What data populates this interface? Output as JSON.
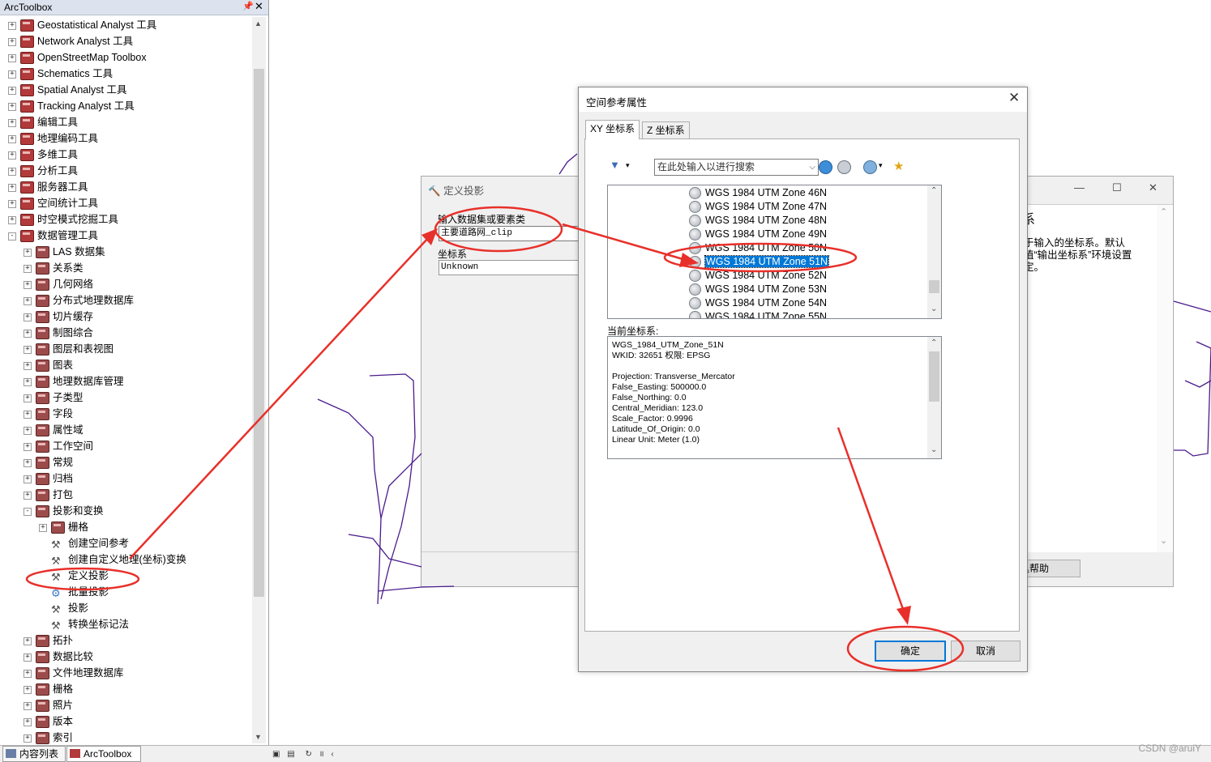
{
  "toolbox": {
    "title": "ArcToolbox",
    "pin_icon": "pin-icon",
    "close_icon": "close-icon",
    "items": [
      {
        "label": "Geostatistical Analyst 工具",
        "level": 0,
        "expand": "+",
        "icon": "toolbox-icon"
      },
      {
        "label": "Network Analyst 工具",
        "level": 0,
        "expand": "+",
        "icon": "toolbox-icon"
      },
      {
        "label": "OpenStreetMap Toolbox",
        "level": 0,
        "expand": "+",
        "icon": "toolbox-icon"
      },
      {
        "label": "Schematics 工具",
        "level": 0,
        "expand": "+",
        "icon": "toolbox-icon"
      },
      {
        "label": "Spatial Analyst 工具",
        "level": 0,
        "expand": "+",
        "icon": "toolbox-icon"
      },
      {
        "label": "Tracking Analyst 工具",
        "level": 0,
        "expand": "+",
        "icon": "toolbox-icon"
      },
      {
        "label": "编辑工具",
        "level": 0,
        "expand": "+",
        "icon": "toolbox-icon"
      },
      {
        "label": "地理编码工具",
        "level": 0,
        "expand": "+",
        "icon": "toolbox-icon"
      },
      {
        "label": "多维工具",
        "level": 0,
        "expand": "+",
        "icon": "toolbox-icon"
      },
      {
        "label": "分析工具",
        "level": 0,
        "expand": "+",
        "icon": "toolbox-icon"
      },
      {
        "label": "服务器工具",
        "level": 0,
        "expand": "+",
        "icon": "toolbox-icon"
      },
      {
        "label": "空间统计工具",
        "level": 0,
        "expand": "+",
        "icon": "toolbox-icon"
      },
      {
        "label": "时空模式挖掘工具",
        "level": 0,
        "expand": "+",
        "icon": "toolbox-icon"
      },
      {
        "label": "数据管理工具",
        "level": 0,
        "expand": "-",
        "icon": "toolbox-icon"
      },
      {
        "label": "LAS 数据集",
        "level": 1,
        "expand": "+",
        "icon": "toolset-icon"
      },
      {
        "label": "关系类",
        "level": 1,
        "expand": "+",
        "icon": "toolset-icon"
      },
      {
        "label": "几何网络",
        "level": 1,
        "expand": "+",
        "icon": "toolset-icon"
      },
      {
        "label": "分布式地理数据库",
        "level": 1,
        "expand": "+",
        "icon": "toolset-icon"
      },
      {
        "label": "切片缓存",
        "level": 1,
        "expand": "+",
        "icon": "toolset-icon"
      },
      {
        "label": "制图综合",
        "level": 1,
        "expand": "+",
        "icon": "toolset-icon"
      },
      {
        "label": "图层和表视图",
        "level": 1,
        "expand": "+",
        "icon": "toolset-icon"
      },
      {
        "label": "图表",
        "level": 1,
        "expand": "+",
        "icon": "toolset-icon"
      },
      {
        "label": "地理数据库管理",
        "level": 1,
        "expand": "+",
        "icon": "toolset-icon"
      },
      {
        "label": "子类型",
        "level": 1,
        "expand": "+",
        "icon": "toolset-icon"
      },
      {
        "label": "字段",
        "level": 1,
        "expand": "+",
        "icon": "toolset-icon"
      },
      {
        "label": "属性域",
        "level": 1,
        "expand": "+",
        "icon": "toolset-icon"
      },
      {
        "label": "工作空间",
        "level": 1,
        "expand": "+",
        "icon": "toolset-icon"
      },
      {
        "label": "常规",
        "level": 1,
        "expand": "+",
        "icon": "toolset-icon"
      },
      {
        "label": "归档",
        "level": 1,
        "expand": "+",
        "icon": "toolset-icon"
      },
      {
        "label": "打包",
        "level": 1,
        "expand": "+",
        "icon": "toolset-icon"
      },
      {
        "label": "投影和变换",
        "level": 1,
        "expand": "-",
        "icon": "toolset-icon"
      },
      {
        "label": "栅格",
        "level": 2,
        "expand": "+",
        "icon": "toolset-icon"
      },
      {
        "label": "创建空间参考",
        "level": 2,
        "expand": "",
        "icon": "hammer-icon"
      },
      {
        "label": "创建自定义地理(坐标)变换",
        "level": 2,
        "expand": "",
        "icon": "hammer-icon"
      },
      {
        "label": "定义投影",
        "level": 2,
        "expand": "",
        "icon": "hammer-icon"
      },
      {
        "label": "批量投影",
        "level": 2,
        "expand": "",
        "icon": "script-icon"
      },
      {
        "label": "投影",
        "level": 2,
        "expand": "",
        "icon": "hammer-icon"
      },
      {
        "label": "转换坐标记法",
        "level": 2,
        "expand": "",
        "icon": "hammer-icon"
      },
      {
        "label": "拓扑",
        "level": 1,
        "expand": "+",
        "icon": "toolset-icon"
      },
      {
        "label": "数据比较",
        "level": 1,
        "expand": "+",
        "icon": "toolset-icon"
      },
      {
        "label": "文件地理数据库",
        "level": 1,
        "expand": "+",
        "icon": "toolset-icon"
      },
      {
        "label": "栅格",
        "level": 1,
        "expand": "+",
        "icon": "toolset-icon"
      },
      {
        "label": "照片",
        "level": 1,
        "expand": "+",
        "icon": "toolset-icon"
      },
      {
        "label": "版本",
        "level": 1,
        "expand": "+",
        "icon": "toolset-icon"
      },
      {
        "label": "索引",
        "level": 1,
        "expand": "+",
        "icon": "toolset-icon"
      }
    ]
  },
  "bottom_tabs": {
    "contents": "内容列表",
    "arctoolbox": "ArcToolbox"
  },
  "watermark": "CSDN @aruiY",
  "define_projection": {
    "title": "定义投影",
    "input_label": "输入数据集或要素类",
    "input_value": "主要道路网_clip",
    "cs_label": "坐标系",
    "cs_value": "Unknown"
  },
  "help_panel": {
    "heading": "系",
    "text": "于输入的坐标系。默认值“输出坐标系”环境设置定。",
    "help_button": "具帮助"
  },
  "spatial_reference": {
    "title": "空间参考属性",
    "tabs": [
      "XY 坐标系",
      "Z 坐标系"
    ],
    "search_placeholder": "在此处输入以进行搜索",
    "list": [
      "WGS 1984 UTM Zone 46N",
      "WGS 1984 UTM Zone 47N",
      "WGS 1984 UTM Zone 48N",
      "WGS 1984 UTM Zone 49N",
      "WGS 1984 UTM Zone 50N",
      "WGS 1984 UTM Zone 51N",
      "WGS 1984 UTM Zone 52N",
      "WGS 1984 UTM Zone 53N",
      "WGS 1984 UTM Zone 54N",
      "WGS 1984 UTM Zone 55N"
    ],
    "selected": "WGS 1984 UTM Zone 51N",
    "current_label": "当前坐标系:",
    "current_text": "WGS_1984_UTM_Zone_51N\nWKID: 32651 权限: EPSG\n\nProjection: Transverse_Mercator\nFalse_Easting: 500000.0\nFalse_Northing: 0.0\nCentral_Meridian: 123.0\nScale_Factor: 0.9996\nLatitude_Of_Origin: 0.0\nLinear Unit: Meter (1.0)",
    "ok": "确定",
    "cancel": "取消"
  },
  "colors": {
    "annotation": "#e8302a",
    "selection": "#0078d7",
    "map_lines": "#4a1a8c"
  }
}
